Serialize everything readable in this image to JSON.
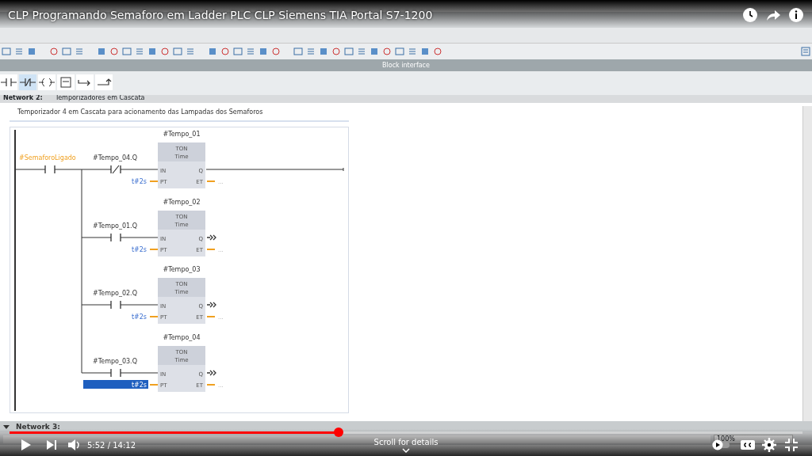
{
  "video": {
    "title": "CLP Programando Semaforo em Ladder PLC CLP Siemens TIA Portal S7-1200",
    "time": "5:52 / 14:12",
    "scroll_hint": "Scroll for details",
    "progress": {
      "level": 0.415
    },
    "autoplay_on": false
  },
  "editor": {
    "panel_label": "Block interface",
    "network": {
      "title": "Network 2:",
      "subtitle": "Temporizadores em Cascata",
      "comment": "Temporizador 4 em Cascata para acionamento das Lampadas dos Semaforos",
      "main_contact": "#SemaforoLigado",
      "rungs": [
        {
          "contact": {
            "kind": "nc",
            "tag": "#Tempo_04.Q"
          },
          "instance": "#Tempo_01",
          "type": "TON",
          "subtype": "Time",
          "pins": {
            "in": "IN",
            "pt": "PT",
            "q": "Q",
            "et": "ET"
          },
          "pt_value": "t#2s",
          "pt_selected": false,
          "q_output": {
            "kind": "wire"
          },
          "et_value": "..."
        },
        {
          "contact": {
            "kind": "no",
            "tag": "#Tempo_01.Q"
          },
          "instance": "#Tempo_02",
          "type": "TON",
          "subtype": "Time",
          "pins": {
            "in": "IN",
            "pt": "PT",
            "q": "Q",
            "et": "ET"
          },
          "pt_value": "t#2s",
          "pt_selected": false,
          "q_output": {
            "kind": "open"
          },
          "et_value": "..."
        },
        {
          "contact": {
            "kind": "no",
            "tag": "#Tempo_02.Q"
          },
          "instance": "#Tempo_03",
          "type": "TON",
          "subtype": "Time",
          "pins": {
            "in": "IN",
            "pt": "PT",
            "q": "Q",
            "et": "ET"
          },
          "pt_value": "t#2s",
          "pt_selected": false,
          "q_output": {
            "kind": "open"
          },
          "et_value": "..."
        },
        {
          "contact": {
            "kind": "no",
            "tag": "#Tempo_03.Q"
          },
          "instance": "#Tempo_04",
          "type": "TON",
          "subtype": "Time",
          "pins": {
            "in": "IN",
            "pt": "PT",
            "q": "Q",
            "et": "ET"
          },
          "pt_value": "t#2s",
          "pt_selected": true,
          "q_output": {
            "kind": "open"
          },
          "et_value": "..."
        }
      ]
    },
    "next_network": "Network 3:",
    "zoom": "100%"
  }
}
